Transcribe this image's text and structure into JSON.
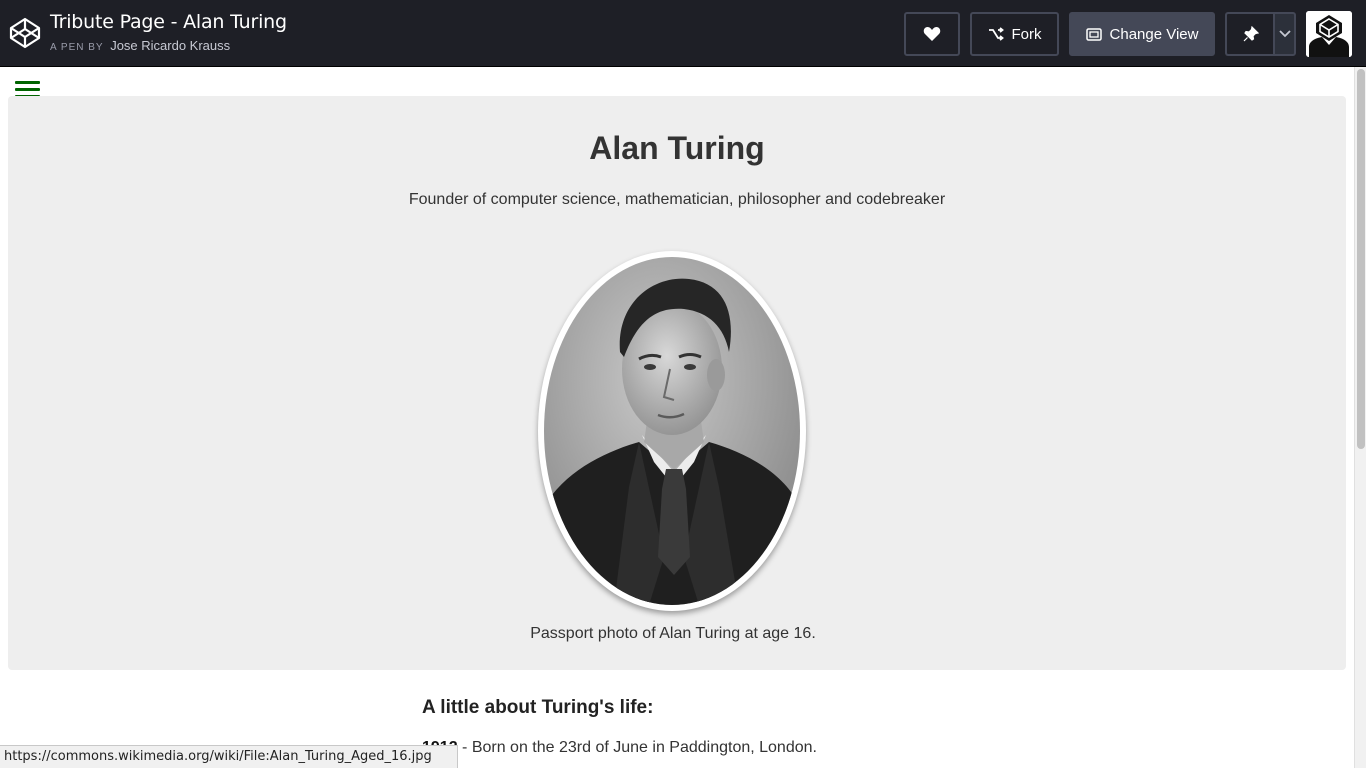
{
  "header": {
    "title": "Tribute Page - Alan Turing",
    "pen_by": "A PEN BY",
    "author": "Jose Ricardo Krauss",
    "buttons": {
      "fork": "Fork",
      "change_view": "Change View"
    },
    "icons": [
      "codepen-logo-icon",
      "heart-icon",
      "fork-icon",
      "change-view-icon",
      "pin-icon",
      "chevron-down-icon"
    ]
  },
  "tribute": {
    "title": "Alan Turing",
    "subtitle": "Founder of computer science, mathematician, philosopher and codebreaker",
    "caption": "Passport photo of Alan Turing at age 16.",
    "life_heading": "A little about Turing's life:",
    "timeline": [
      {
        "year": "1912",
        "text": " - Born on the 23rd of June in Paddington, London."
      }
    ]
  },
  "status_bar": {
    "url": "https://commons.wikimedia.org/wiki/File:Alan_Turing_Aged_16.jpg"
  },
  "colors": {
    "header_bg": "#1e1f26",
    "hamburger": "#006400",
    "hero_bg": "#eeeeee"
  }
}
